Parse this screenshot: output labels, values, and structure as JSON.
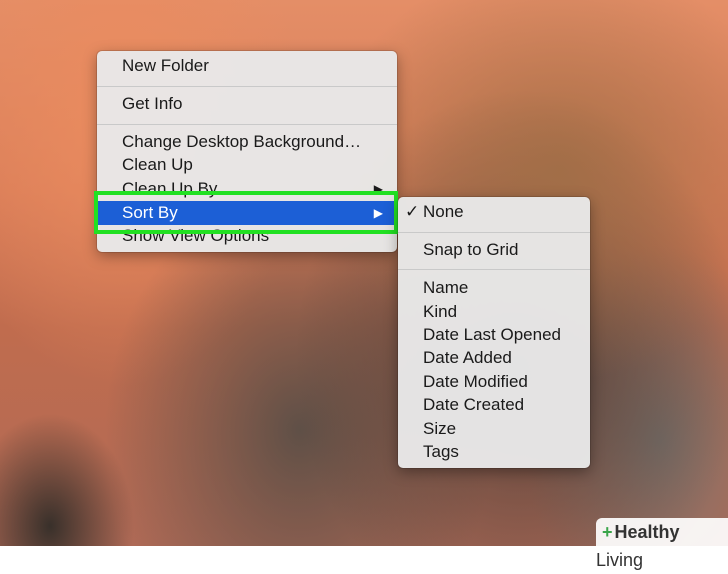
{
  "context_menu": {
    "items": {
      "new_folder": "New Folder",
      "get_info": "Get Info",
      "change_background": "Change Desktop Background…",
      "clean_up": "Clean Up",
      "clean_up_by": "Clean Up By",
      "sort_by": "Sort By",
      "show_view_options": "Show View Options"
    },
    "submenu_arrow": "▶"
  },
  "sort_submenu": {
    "check_mark": "✓",
    "none": "None",
    "snap_to_grid": "Snap to Grid",
    "options": [
      "Name",
      "Kind",
      "Date Last Opened",
      "Date Added",
      "Date Modified",
      "Date Created",
      "Size",
      "Tags"
    ]
  },
  "watermark": {
    "plus": "+",
    "brand_bold": "Healthy",
    "brand_rest": " Living"
  },
  "colors": {
    "highlight": "#1c5fd6",
    "annotation_outline": "#22e022"
  }
}
